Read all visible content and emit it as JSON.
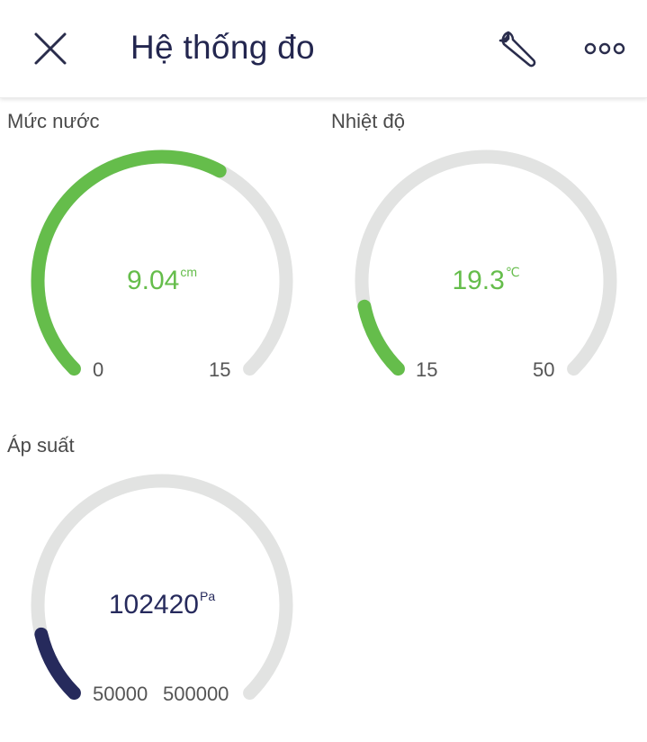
{
  "header": {
    "title": "Hệ thống đo",
    "close_icon": "close-icon",
    "wrench_icon": "wrench-icon",
    "more_icon": "more-options-icon"
  },
  "colors": {
    "green": "#65bd4b",
    "navy": "#262a5c",
    "track": "#e2e3e2"
  },
  "gauges": [
    {
      "label": "Mức nước",
      "value": "9.04",
      "value_num": 9.04,
      "unit": "cm",
      "min": "0",
      "max": "15",
      "min_num": 0,
      "max_num": 15,
      "color": "green"
    },
    {
      "label": "Nhiệt độ",
      "value": "19.3",
      "value_num": 19.3,
      "unit": "℃",
      "min": "15",
      "max": "50",
      "min_num": 15,
      "max_num": 50,
      "color": "green"
    },
    {
      "label": "Áp suất",
      "value": "102420",
      "value_num": 102420,
      "unit": "Pa",
      "min": "50000",
      "max": "500000",
      "min_num": 50000,
      "max_num": 500000,
      "color": "navy"
    }
  ]
}
